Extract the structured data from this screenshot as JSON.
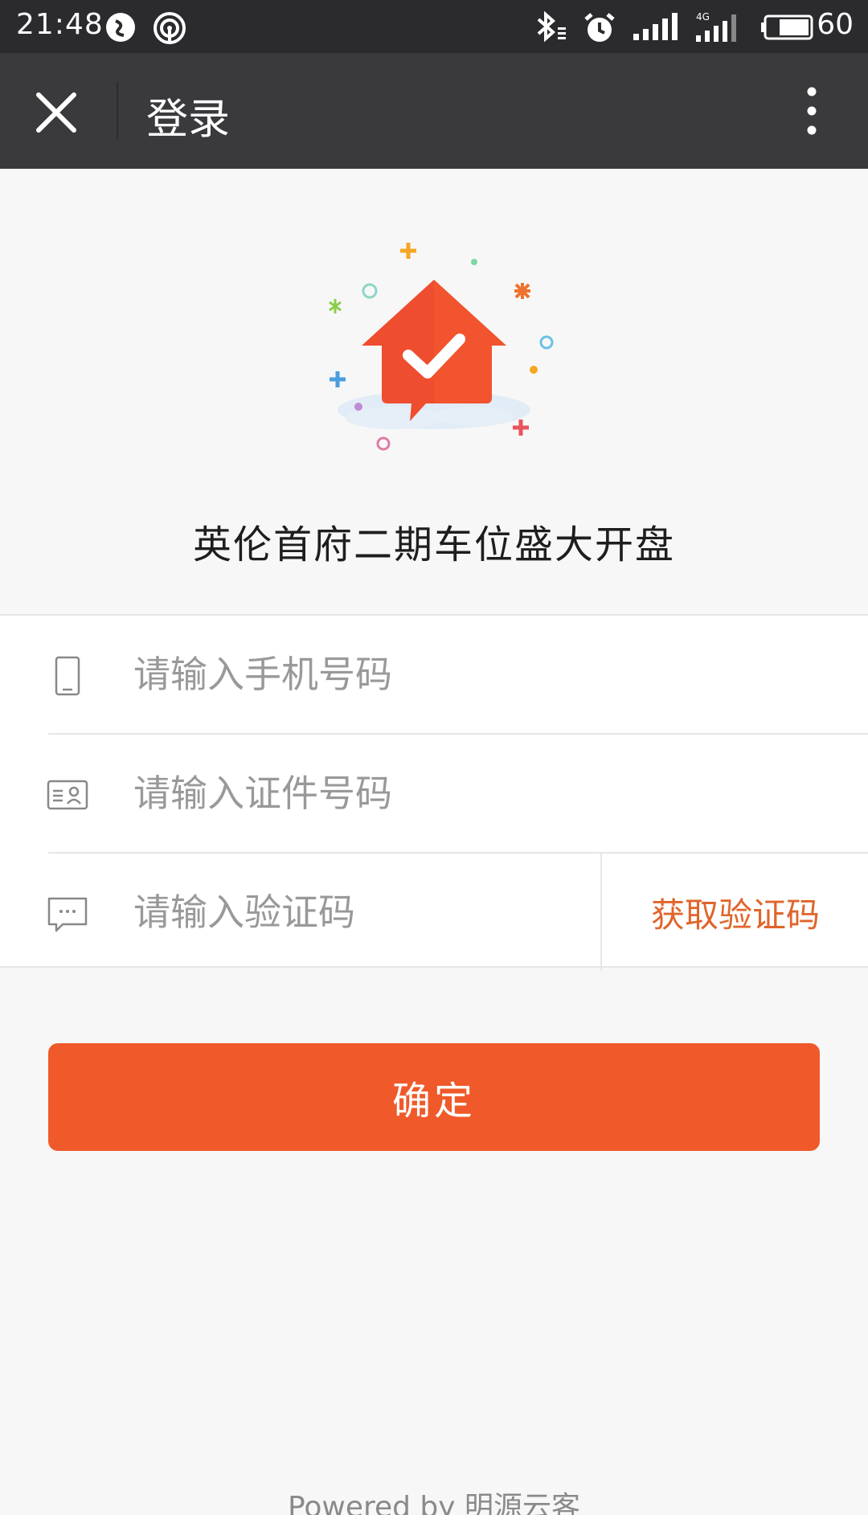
{
  "status_bar": {
    "time": "21:48",
    "battery": "60",
    "network": "4G"
  },
  "nav": {
    "title": "登录"
  },
  "brand": {
    "title": "英伦首府二期车位盛大开盘"
  },
  "form": {
    "phone": {
      "value": "",
      "placeholder": "请输入手机号码"
    },
    "id_number": {
      "value": "",
      "placeholder": "请输入证件号码"
    },
    "code": {
      "value": "",
      "placeholder": "请输入验证码"
    },
    "get_code_label": "获取验证码"
  },
  "submit_label": "确定",
  "footer": "Powered by 明源云客",
  "colors": {
    "accent": "#f05a2a",
    "link": "#e0652b",
    "nav_bg": "#3a3a3d",
    "page_bg": "#f7f7f7"
  }
}
